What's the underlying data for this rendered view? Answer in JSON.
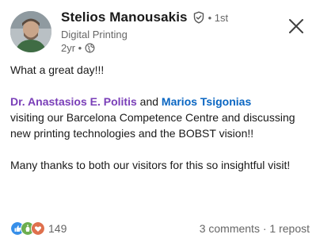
{
  "author": {
    "name": "Stelios Manousakis",
    "degree": "• 1st",
    "headline": "Digital Printing",
    "time": "2yr •",
    "visibility_icon": "globe-icon",
    "verified_icon": "verified-shield-icon"
  },
  "post": {
    "line1": "What a great day!!!",
    "mention1": "Dr. Anastasios E. Politis",
    "connector": " and ",
    "mention2": "Marios Tsigonias",
    "line2": "visiting our Barcelona Competence Centre and discussing new printing technologies and the BOBST vision!!",
    "line3": "Many thanks to both our visitors for this so insightful visit!"
  },
  "social": {
    "reaction_count": "149",
    "comments": "3 comments",
    "separator": " · ",
    "reposts": "1 repost"
  },
  "colors": {
    "mention1": "#7a3fb8",
    "mention2": "#0a66c2",
    "like": "#378fe9",
    "celebrate": "#44712e",
    "love": "#df704d"
  }
}
